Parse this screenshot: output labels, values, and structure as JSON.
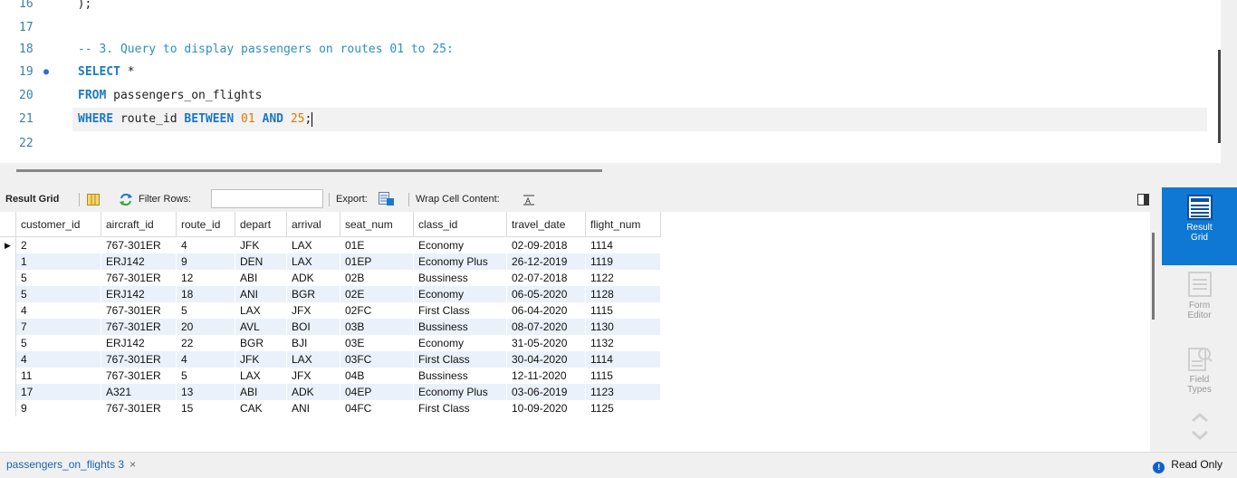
{
  "editor": {
    "lines": [
      {
        "num": "16",
        "text": "  );"
      },
      {
        "num": "17",
        "text": ""
      },
      {
        "num": "18",
        "comment": "-- 3. Query to display passengers on routes 01 to 25:"
      },
      {
        "num": "19",
        "kw1": "SELECT",
        "rest1": " *"
      },
      {
        "num": "20",
        "kw1": "FROM",
        "rest1": " passengers_on_flights"
      },
      {
        "num": "21",
        "kw1": "WHERE",
        "rest1": " route_id ",
        "kw2": "BETWEEN",
        "n1": "01",
        "kw3": "AND",
        "n2": "25",
        "end": ";"
      },
      {
        "num": "22",
        "text": ""
      }
    ]
  },
  "toolbar": {
    "result_grid": "Result Grid",
    "filter_rows": "Filter Rows:",
    "export": "Export:",
    "wrap": "Wrap Cell Content:"
  },
  "grid": {
    "columns": [
      "customer_id",
      "aircraft_id",
      "route_id",
      "depart",
      "arrival",
      "seat_num",
      "class_id",
      "travel_date",
      "flight_num"
    ],
    "rows": [
      [
        "2",
        "767-301ER",
        "4",
        "JFK",
        "LAX",
        "01E",
        "Economy",
        "02-09-2018",
        "1114"
      ],
      [
        "1",
        "ERJ142",
        "9",
        "DEN",
        "LAX",
        "01EP",
        "Economy Plus",
        "26-12-2019",
        "1119"
      ],
      [
        "5",
        "767-301ER",
        "12",
        "ABI",
        "ADK",
        "02B",
        "Bussiness",
        "02-07-2018",
        "1122"
      ],
      [
        "5",
        "ERJ142",
        "18",
        "ANI",
        "BGR",
        "02E",
        "Economy",
        "06-05-2020",
        "1128"
      ],
      [
        "4",
        "767-301ER",
        "5",
        "LAX",
        "JFX",
        "02FC",
        "First Class",
        "06-04-2020",
        "1115"
      ],
      [
        "7",
        "767-301ER",
        "20",
        "AVL",
        "BOI",
        "03B",
        "Bussiness",
        "08-07-2020",
        "1130"
      ],
      [
        "5",
        "ERJ142",
        "22",
        "BGR",
        "BJI",
        "03E",
        "Economy",
        "31-05-2020",
        "1132"
      ],
      [
        "4",
        "767-301ER",
        "4",
        "JFK",
        "LAX",
        "03FC",
        "First Class",
        "30-04-2020",
        "1114"
      ],
      [
        "11",
        "767-301ER",
        "5",
        "LAX",
        "JFX",
        "04B",
        "Bussiness",
        "12-11-2020",
        "1115"
      ],
      [
        "17",
        "A321",
        "13",
        "ABI",
        "ADK",
        "04EP",
        "Economy Plus",
        "03-06-2019",
        "1123"
      ],
      [
        "9",
        "767-301ER",
        "15",
        "CAK",
        "ANI",
        "04FC",
        "First Class",
        "10-09-2020",
        "1125"
      ]
    ]
  },
  "side": {
    "result_grid_1": "Result",
    "result_grid_2": "Grid",
    "form_editor_1": "Form",
    "form_editor_2": "Editor",
    "field_types_1": "Field",
    "field_types_2": "Types"
  },
  "status": {
    "tab": "passengers_on_flights 3",
    "close": "×",
    "read_only": "Read Only"
  },
  "colors": {
    "accent": "#0f78d4",
    "keyword": "#1d78c8",
    "number": "#e07a00",
    "row_alt": "#eaf1fb"
  }
}
